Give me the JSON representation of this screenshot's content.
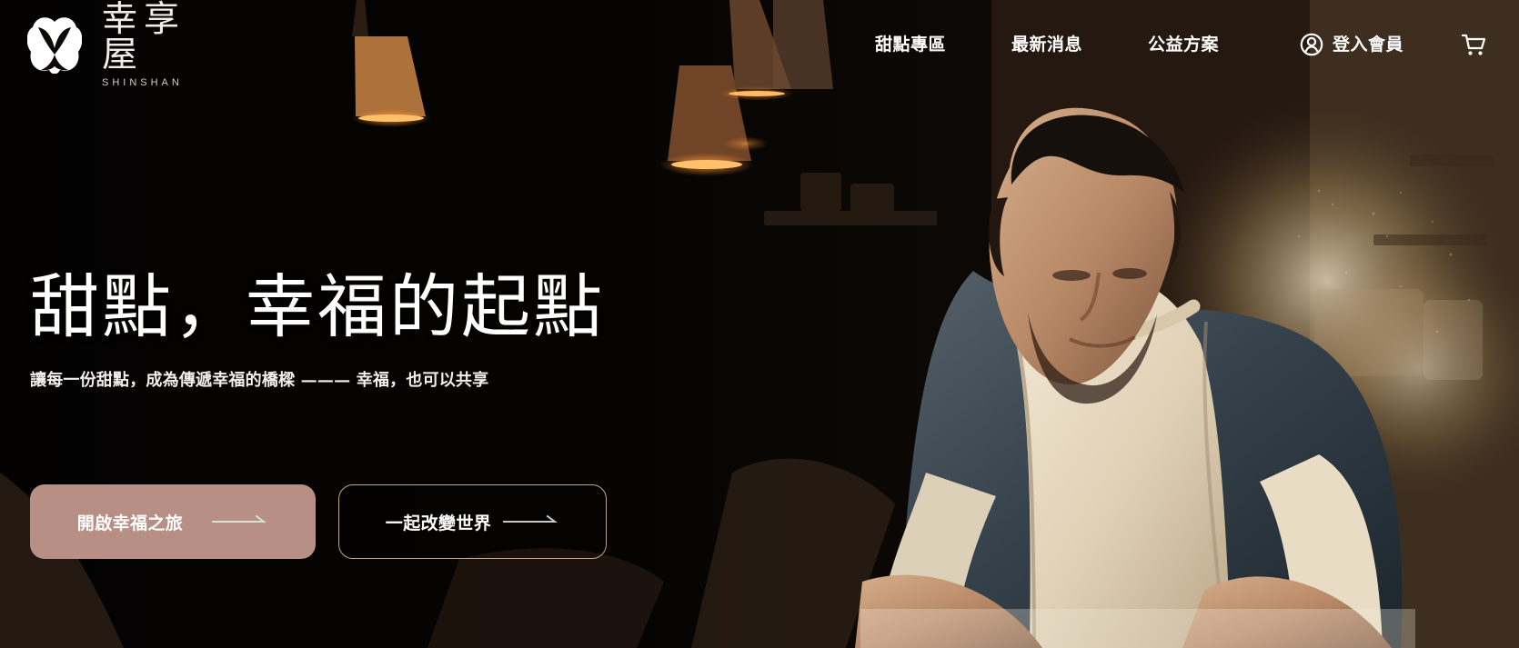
{
  "brand": {
    "name": "幸享屋",
    "subtitle": "SHINSHAN",
    "logo_icon": "flower-cup-logo-icon",
    "logo_color": "#ffffff"
  },
  "navigation": {
    "items": [
      {
        "label": "甜點專區"
      },
      {
        "label": "最新消息"
      },
      {
        "label": "公益方案"
      }
    ],
    "login": {
      "label": "登入會員",
      "icon": "user-circle-icon"
    },
    "cart": {
      "icon": "shopping-cart-icon"
    }
  },
  "hero": {
    "title": "甜點，幸福的起點",
    "subtitle": "讓每一份甜點，成為傳遞幸福的橋樑 ——— 幸福，也可以共享",
    "background_image": "baker-kneading-dough-in-warm-kitchen",
    "buttons": [
      {
        "label": "開啟幸福之旅",
        "style": "filled",
        "icon": "arrow-right-icon"
      },
      {
        "label": "一起改變世界",
        "style": "outline",
        "icon": "arrow-right-icon"
      }
    ]
  },
  "colors": {
    "text_primary": "#ffffff",
    "cta_primary_bg": "#b88f84",
    "cta_outline": "#c4a781",
    "background_dark": "#0d0906",
    "background_warm": "#6d5336"
  }
}
